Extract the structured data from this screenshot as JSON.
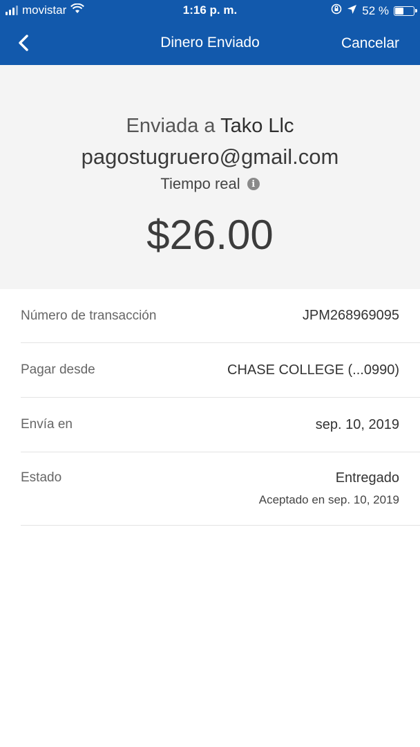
{
  "status_bar": {
    "carrier": "movistar",
    "time": "1:16 p. m.",
    "battery": "52 %",
    "battery_level": 0.52
  },
  "nav": {
    "title": "Dinero Enviado",
    "cancel_label": "Cancelar",
    "back_icon": "chevron-left-icon"
  },
  "hero": {
    "sent_prefix": "Enviada a",
    "recipient": "Tako Llc",
    "email": "pagostugruero@gmail.com",
    "speed": "Tiempo real",
    "amount": "$26.00"
  },
  "details": {
    "transaction": {
      "label": "Número de transacción",
      "value": "JPM268969095"
    },
    "pay_from": {
      "label": "Pagar desde",
      "value": "CHASE COLLEGE (...0990)"
    },
    "send_on": {
      "label": "Envía en",
      "value": "sep. 10, 2019"
    },
    "status": {
      "label": "Estado",
      "value": "Entregado",
      "sub": "Aceptado en sep. 10, 2019"
    }
  }
}
